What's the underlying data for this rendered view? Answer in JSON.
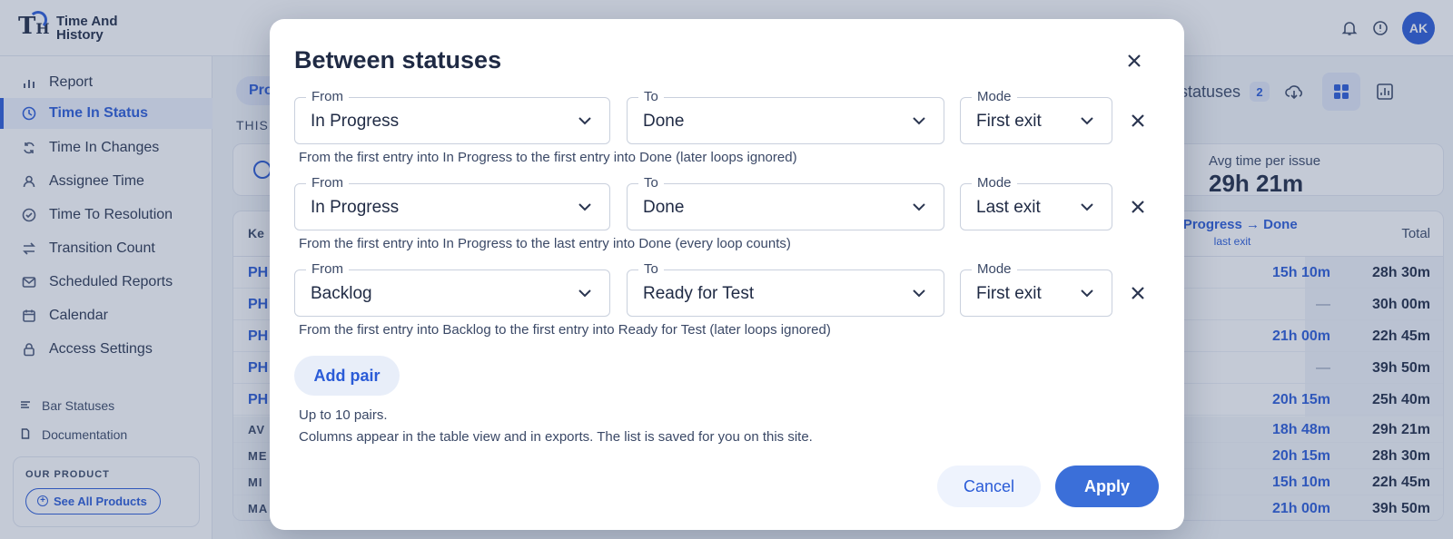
{
  "app": {
    "name": "Time And History",
    "avatar_initials": "AK"
  },
  "sidebar": {
    "items": [
      {
        "label": "Report",
        "icon": "bar-chart-icon"
      },
      {
        "label": "Time In Status",
        "icon": "clock-icon",
        "active": true
      },
      {
        "label": "Time In Changes",
        "icon": "refresh-icon"
      },
      {
        "label": "Assignee Time",
        "icon": "user-icon"
      },
      {
        "label": "Time To Resolution",
        "icon": "check-circle-icon"
      },
      {
        "label": "Transition Count",
        "icon": "transfer-icon"
      },
      {
        "label": "Scheduled Reports",
        "icon": "mail-icon"
      },
      {
        "label": "Calendar",
        "icon": "calendar-icon"
      },
      {
        "label": "Access Settings",
        "icon": "lock-icon"
      }
    ],
    "secondary": [
      {
        "label": "Bar Statuses",
        "icon": "bars-icon"
      },
      {
        "label": "Documentation",
        "icon": "document-icon"
      }
    ],
    "product_box": {
      "label": "OUR PRODUCT",
      "button": "See All Products"
    }
  },
  "main": {
    "chip": "Pro",
    "this_label": "THIS",
    "between_button": {
      "label": "n statuses",
      "count": "2"
    },
    "stats": {
      "label": "Avg time per issue",
      "value": "29h 21m"
    },
    "table": {
      "key_header": "Ke",
      "pair_header": "In Progress → Done",
      "pair_mode": "last exit",
      "total_header": "Total",
      "rows": [
        {
          "key": "PH",
          "pair": "15h 10m",
          "total": "28h 30m"
        },
        {
          "key": "PH",
          "pair": "—",
          "total": "30h 00m"
        },
        {
          "key": "PH",
          "pair": "21h 00m",
          "total": "22h 45m"
        },
        {
          "key": "PH",
          "pair": "—",
          "total": "39h 50m"
        },
        {
          "key": "PH",
          "pair": "20h 15m",
          "total": "25h 40m"
        }
      ],
      "summary": [
        {
          "key": "AV",
          "pair": "18h 48m",
          "total": "29h 21m"
        },
        {
          "key": "ME",
          "pair": "20h 15m",
          "total": "28h 30m"
        },
        {
          "key": "MI",
          "pair": "15h 10m",
          "total": "22h 45m"
        },
        {
          "key": "MA",
          "pair": "21h 00m",
          "total": "39h 50m"
        }
      ]
    }
  },
  "modal": {
    "title": "Between statuses",
    "labels": {
      "from": "From",
      "to": "To",
      "mode": "Mode"
    },
    "pairs": [
      {
        "from": "In Progress",
        "to": "Done",
        "mode": "First exit",
        "description": "From the first entry into In Progress to the first entry into Done (later loops ignored)"
      },
      {
        "from": "In Progress",
        "to": "Done",
        "mode": "Last exit",
        "description": "From the first entry into In Progress to the last entry into Done (every loop counts)"
      },
      {
        "from": "Backlog",
        "to": "Ready for Test",
        "mode": "First exit",
        "description": "From the first entry into Backlog to the first entry into Ready for Test (later loops ignored)"
      }
    ],
    "add_pair": "Add pair",
    "note_limit": "Up to 10 pairs.",
    "note_info": "Columns appear in the table view and in exports. The list is saved for you on this site.",
    "cancel": "Cancel",
    "apply": "Apply"
  },
  "colors": {
    "accent": "#2a5bd7",
    "apply": "#3b6fd9",
    "text": "#1f2a44"
  }
}
